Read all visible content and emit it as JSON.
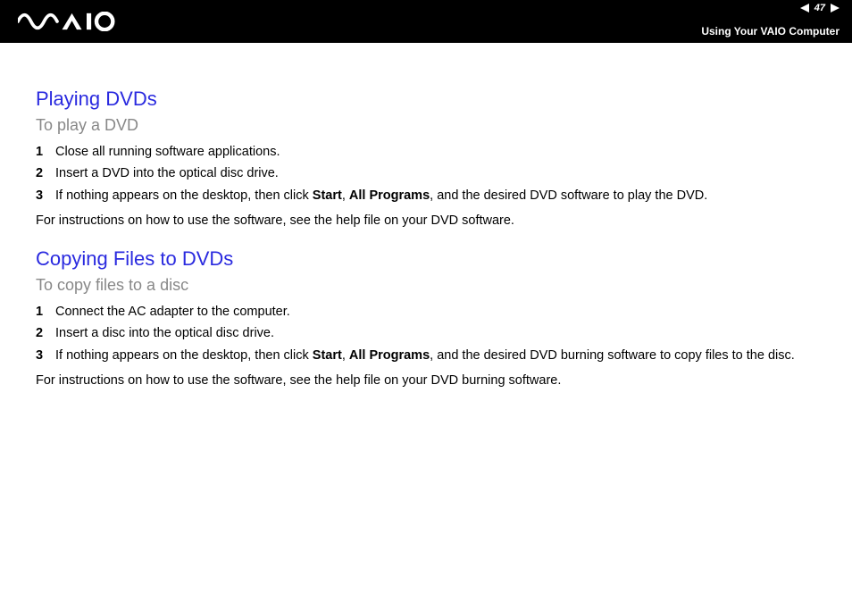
{
  "header": {
    "page_number": "47",
    "subtitle": "Using Your VAIO Computer"
  },
  "sections": [
    {
      "title": "Playing DVDs",
      "subtitle": "To play a DVD",
      "steps": [
        {
          "n": "1",
          "parts": [
            {
              "t": "Close all running software applications."
            }
          ]
        },
        {
          "n": "2",
          "parts": [
            {
              "t": "Insert a DVD into the optical disc drive."
            }
          ]
        },
        {
          "n": "3",
          "parts": [
            {
              "t": "If nothing appears on the desktop, then click "
            },
            {
              "t": "Start",
              "b": true
            },
            {
              "t": ", "
            },
            {
              "t": "All Programs",
              "b": true
            },
            {
              "t": ", and the desired DVD software to play the DVD."
            }
          ]
        }
      ],
      "note": "For instructions on how to use the software, see the help file on your DVD software."
    },
    {
      "title": "Copying Files to DVDs",
      "subtitle": "To copy files to a disc",
      "steps": [
        {
          "n": "1",
          "parts": [
            {
              "t": "Connect the AC adapter to the computer."
            }
          ]
        },
        {
          "n": "2",
          "parts": [
            {
              "t": "Insert a disc into the optical disc drive."
            }
          ]
        },
        {
          "n": "3",
          "parts": [
            {
              "t": "If nothing appears on the desktop, then click "
            },
            {
              "t": "Start",
              "b": true
            },
            {
              "t": ", "
            },
            {
              "t": "All Programs",
              "b": true
            },
            {
              "t": ", and the desired DVD burning software to copy files to the disc."
            }
          ]
        }
      ],
      "note": "For instructions on how to use the software, see the help file on your DVD burning software."
    }
  ]
}
